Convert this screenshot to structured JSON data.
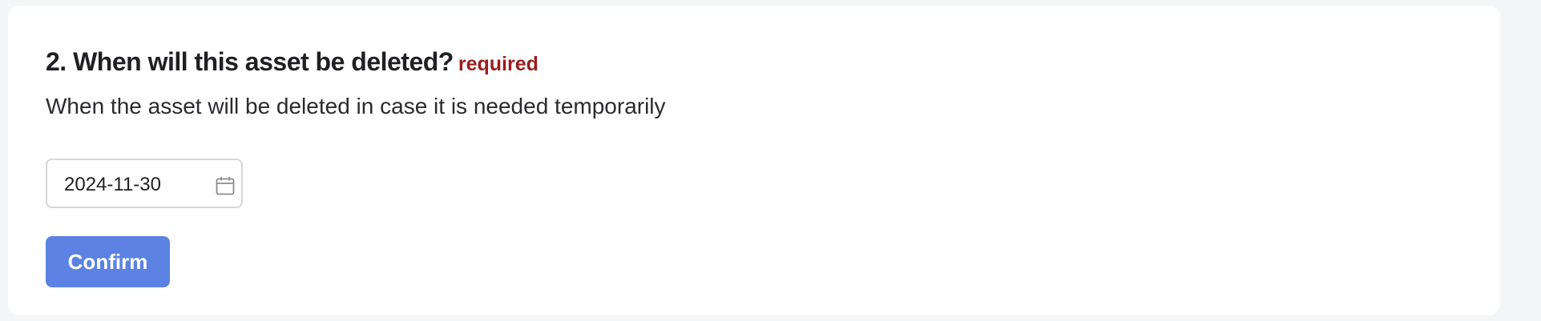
{
  "question": {
    "title": "2. When will this asset be deleted?",
    "required_label": "required",
    "description": "When the asset will be deleted in case it is needed temporarily"
  },
  "date_input": {
    "value": "2024-11-30",
    "icon": "calendar-icon"
  },
  "actions": {
    "confirm_label": "Confirm"
  },
  "colors": {
    "required": "#9b1c1c",
    "confirm_button": "#5b82e2",
    "page_background": "#f4f5f7",
    "card_background": "#ffffff"
  }
}
